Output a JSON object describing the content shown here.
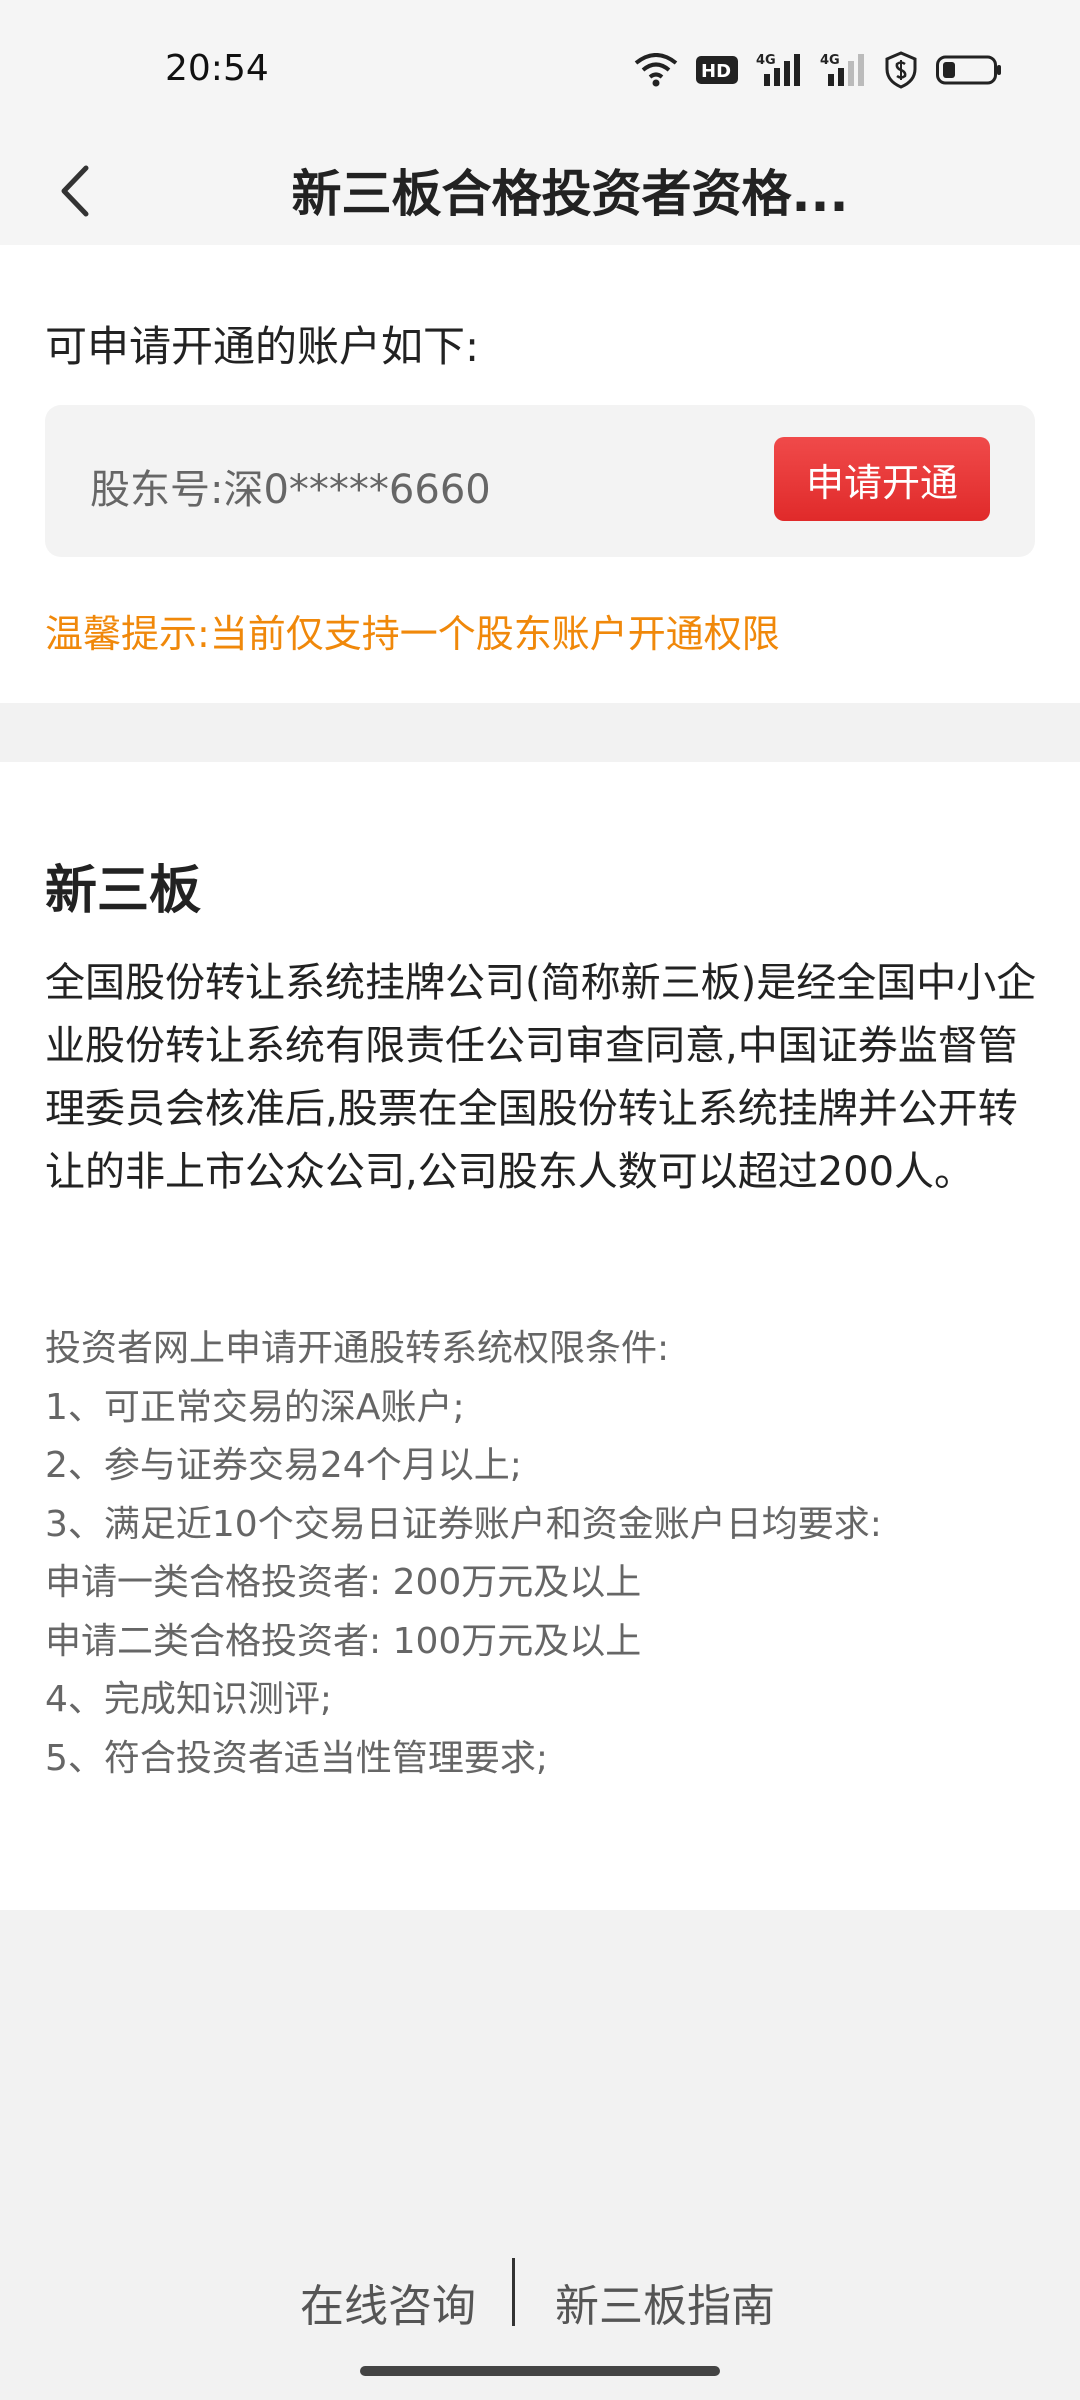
{
  "status_bar": {
    "time": "20:54",
    "icons": [
      "wifi-icon",
      "hd-icon",
      "signal-4g-icon",
      "signal-4g-icon",
      "shield-icon",
      "battery-icon"
    ],
    "hd_label": "HD",
    "net_label": "4G"
  },
  "nav": {
    "title": "新三板合格投资者资格..."
  },
  "accounts": {
    "heading": "可申请开通的账户如下:",
    "card": {
      "label": "股东号:深0*****6660",
      "button": "申请开通"
    },
    "tip": "温馨提示:当前仅支持一个股东账户开通权限"
  },
  "info": {
    "title": "新三板",
    "body": "全国股份转让系统挂牌公司(简称新三板)是经全国中小企业股份转让系统有限责任公司审查同意,中国证券监督管理委员会核准后,股票在全国股份转让系统挂牌并公开转让的非上市公众公司,公司股东人数可以超过200人。",
    "conditions": [
      "投资者网上申请开通股转系统权限条件:",
      "1、可正常交易的深A账户;",
      "2、参与证券交易24个月以上;",
      "3、满足近10个交易日证券账户和资金账户日均要求:",
      "申请一类合格投资者: 200万元及以上",
      "申请二类合格投资者: 100万元及以上",
      "4、完成知识测评;",
      "5、符合投资者适当性管理要求;"
    ]
  },
  "bottom_bar": {
    "consult": "在线咨询",
    "guide": "新三板指南"
  },
  "colors": {
    "accent_red": "#e8383a",
    "tip_orange": "#f0880a"
  }
}
